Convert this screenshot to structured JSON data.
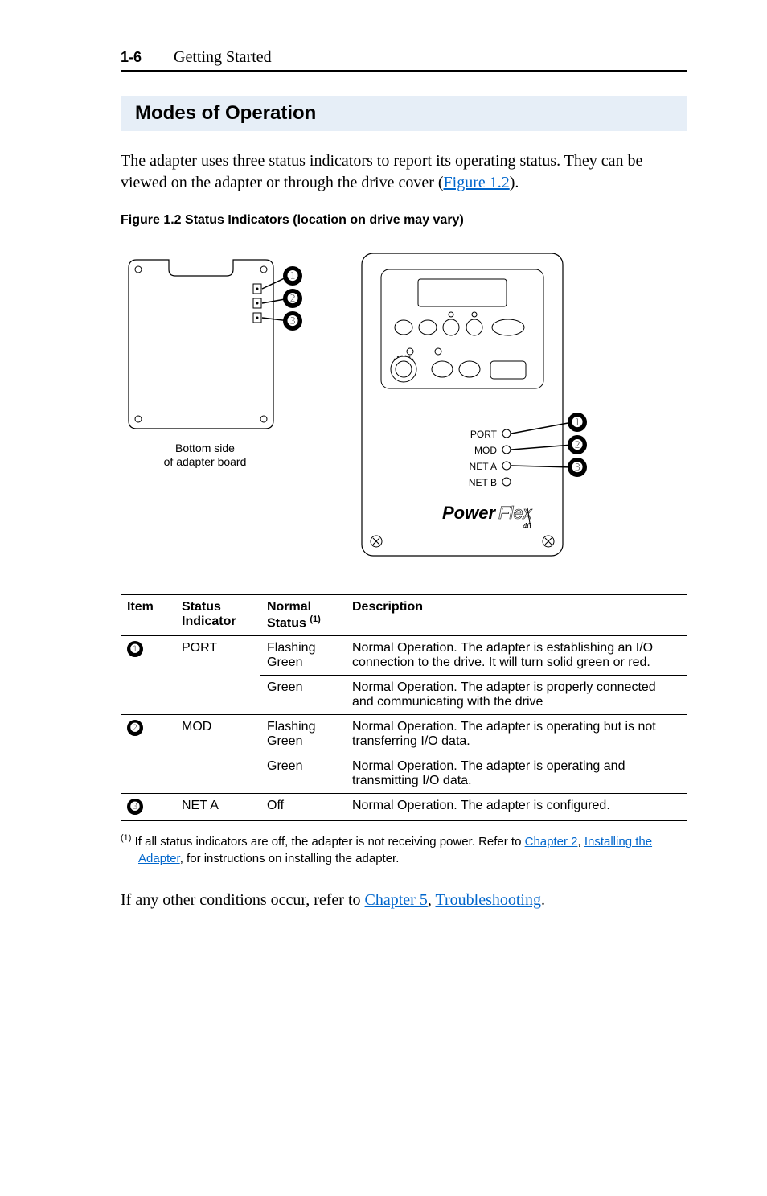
{
  "header": {
    "page_number": "1-6",
    "chapter_title": "Getting Started"
  },
  "section": {
    "title": "Modes of Operation",
    "para1_a": "The adapter uses three status indicators to report its operating status. They can be viewed on the adapter or through the drive cover (",
    "para1_link": "Figure 1.2",
    "para1_b": ")."
  },
  "figure": {
    "caption": "Figure 1.2   Status Indicators (location on drive may vary)",
    "left_caption_line1": "Bottom side",
    "left_caption_line2": "of adapter board",
    "callouts": [
      "➊",
      "➋",
      "➌"
    ],
    "drive_labels": {
      "port": "PORT",
      "mod": "MOD",
      "neta": "NET A",
      "netb": "NET B",
      "brand_bold": "Power",
      "brand_italic": "Flex",
      "brand_sub": "40"
    }
  },
  "table": {
    "headers": {
      "item": "Item",
      "indicator": "Status Indicator",
      "status": "Normal Status",
      "status_sup": "(1)",
      "desc": "Description"
    },
    "rows": [
      {
        "item_sym": "➊",
        "indicator": "PORT",
        "status": "Flashing Green",
        "desc": "Normal Operation. The adapter is establishing an I/O connection to the drive. It will turn solid green or red."
      },
      {
        "item_sym": "",
        "indicator": "",
        "status": "Green",
        "desc": "Normal Operation. The adapter is properly connected and communicating with the drive"
      },
      {
        "item_sym": "➋",
        "indicator": "MOD",
        "status": "Flashing Green",
        "desc": "Normal Operation. The adapter is operating but is not transferring I/O data."
      },
      {
        "item_sym": "",
        "indicator": "",
        "status": "Green",
        "desc": "Normal Operation. The adapter is operating and transmitting I/O data."
      },
      {
        "item_sym": "➌",
        "indicator": "NET A",
        "status": "Off",
        "desc": "Normal Operation. The adapter is configured."
      }
    ]
  },
  "footnote": {
    "marker": "(1)",
    "text_a": "If all status indicators are off, the adapter is not receiving power. Refer to ",
    "link1": "Chapter 2",
    "text_b": ", ",
    "link2": "Installing the Adapter",
    "text_c": ", for instructions on installing the adapter."
  },
  "closing": {
    "text_a": "If any other conditions occur, refer to ",
    "link1": "Chapter 5",
    "text_b": ", ",
    "link2": "Troubleshooting",
    "text_c": "."
  }
}
